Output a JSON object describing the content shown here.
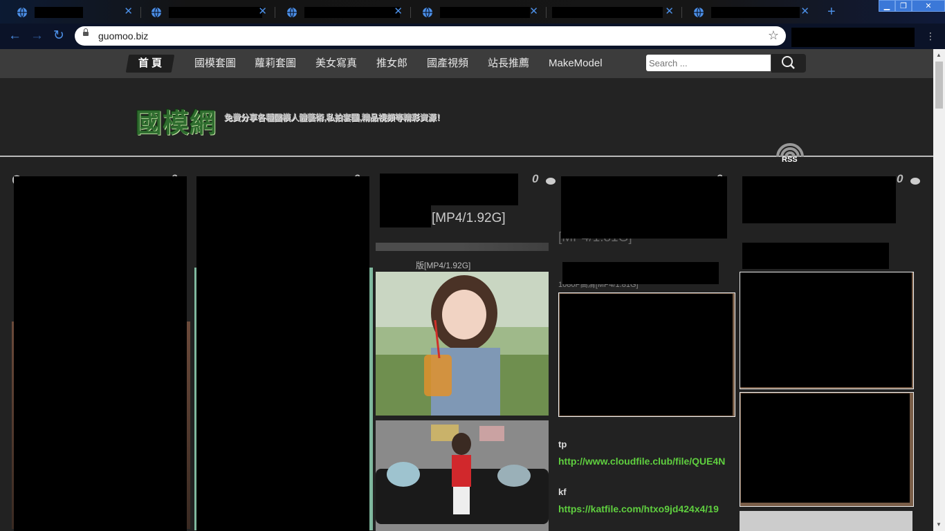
{
  "browser": {
    "tabs": [
      {
        "title": "██████"
      },
      {
        "title": "████████████"
      },
      {
        "title": "████████████"
      },
      {
        "title": "████████████"
      },
      {
        "title": "████████████"
      },
      {
        "title": "████████████"
      }
    ],
    "close_glyph": "✕",
    "new_tab_glyph": "+",
    "back_glyph": "←",
    "forward_glyph": "→",
    "reload_glyph": "↻",
    "url": "guomoo.biz",
    "bookmark_glyph": "☆",
    "window_controls": {
      "minimize": "▁",
      "maximize": "❐",
      "close": "✕"
    },
    "extensions_glyph": "⋮"
  },
  "site": {
    "menu": {
      "home": "首 頁",
      "items": [
        "國模套圖",
        "蘿莉套圖",
        "美女寫真",
        "推女郎",
        "國產視頻",
        "站長推薦",
        "MakeModel"
      ]
    },
    "search": {
      "placeholder": "Search ..."
    },
    "logo": "國模網",
    "slogan": "免費分享各種國模人體藝術,私拍套圖,精品視頻等精彩資源！",
    "rss_label": "RSS"
  },
  "posts": [
    {
      "title_fragment": "C",
      "comments": "0"
    },
    {
      "title_fragment": "",
      "comments": "0"
    },
    {
      "title_fragment": "[MP4/1.92G]",
      "comments": "0",
      "excerpt": "版[MP4/1.92G]"
    },
    {
      "title_fragment": "[MP4/1.81G]",
      "comments": "0",
      "excerpt": "1080P高清[MP4/1.81G]"
    },
    {
      "title_fragment": "",
      "comments": "0"
    }
  ],
  "downloads": [
    {
      "label": "tp",
      "url": "http://www.cloudfile.club/file/QUE4N"
    },
    {
      "label": "kf",
      "url": "https://katfile.com/htxo9jd424x4/19"
    }
  ],
  "colors": {
    "link_green": "#5fcf3f",
    "chrome_blue": "#4c8fe6",
    "menu_bg": "#3c3c3c"
  }
}
